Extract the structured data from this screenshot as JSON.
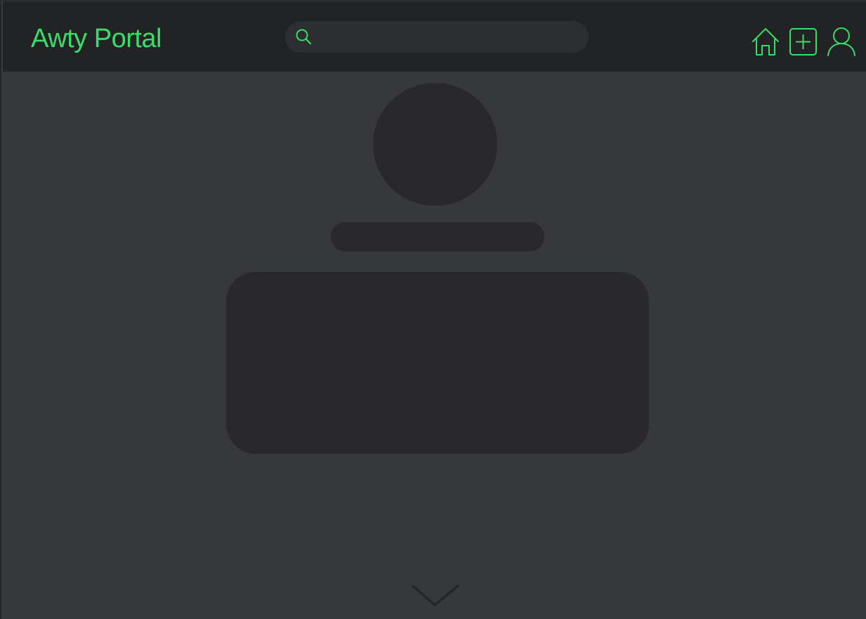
{
  "header": {
    "brand": "Awty Portal",
    "search": {
      "icon": "search-icon",
      "value": "",
      "placeholder": ""
    },
    "nav": [
      {
        "icon": "home-icon"
      },
      {
        "icon": "add-square-icon"
      },
      {
        "icon": "user-icon"
      }
    ]
  },
  "profile": {
    "avatar": "avatar-placeholder",
    "name": "",
    "bio": ""
  },
  "footer": {
    "icon": "chevron-down-icon"
  },
  "colors": {
    "accent": "#3bdd6a",
    "header_bg": "#222325",
    "page_bg": "#37383a",
    "placeholder": "#29292b",
    "search_bg": "#2d2e30"
  }
}
